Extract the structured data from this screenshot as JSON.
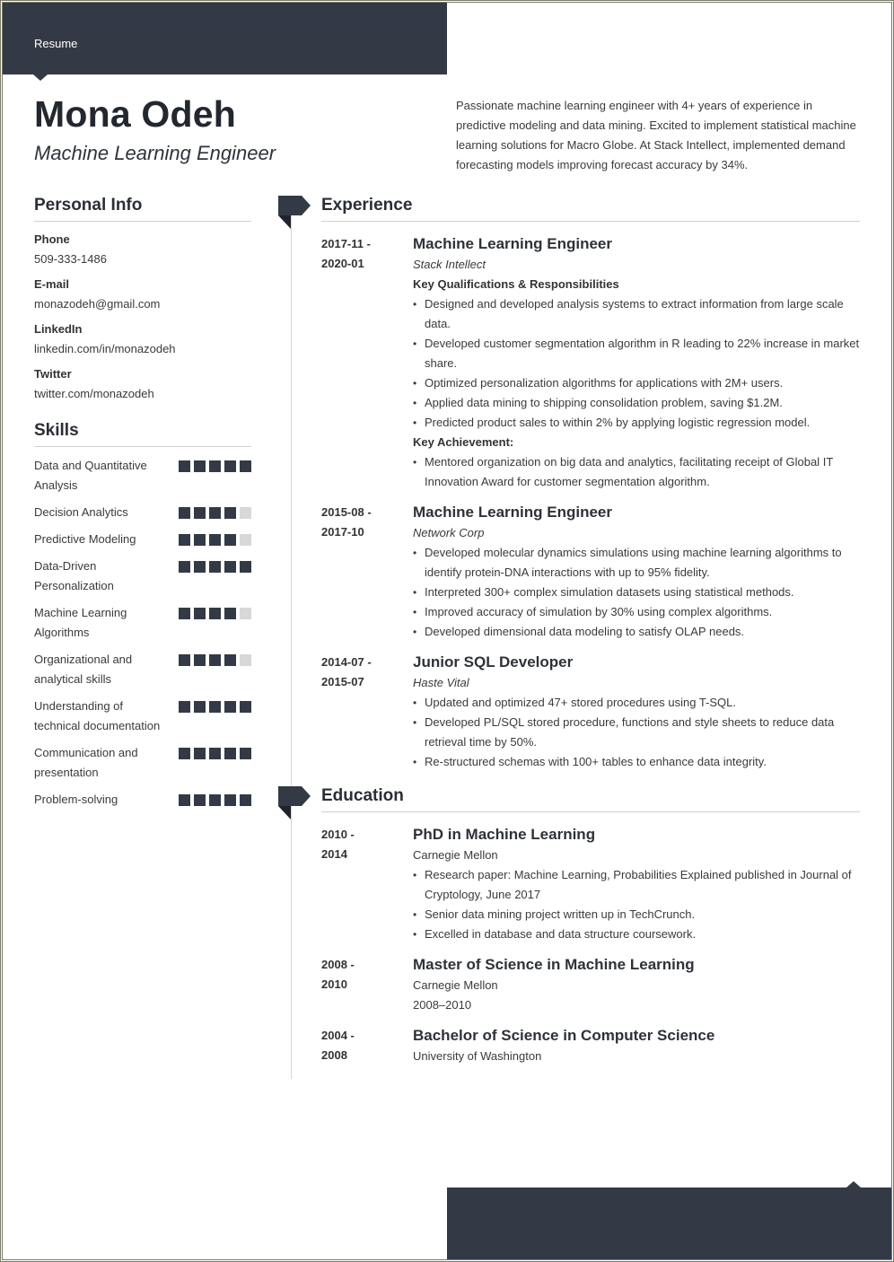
{
  "header": {
    "label": "Resume"
  },
  "profile": {
    "name": "Mona Odeh",
    "title": "Machine Learning Engineer",
    "summary": "Passionate machine learning engineer with 4+ years of experience in predictive modeling and data mining. Excited to implement statistical machine learning solutions for Macro Globe. At Stack Intellect, implemented demand forecasting models improving forecast accuracy by 34%."
  },
  "personal_info": {
    "heading": "Personal Info",
    "items": [
      {
        "label": "Phone",
        "value": "509-333-1486"
      },
      {
        "label": "E-mail",
        "value": "monazodeh@gmail.com"
      },
      {
        "label": "LinkedIn",
        "value": "linkedin.com/in/monazodeh"
      },
      {
        "label": "Twitter",
        "value": "twitter.com/monazodeh"
      }
    ]
  },
  "skills": {
    "heading": "Skills",
    "max_level": 5,
    "items": [
      {
        "name": "Data and Quantitative Analysis",
        "level": 5
      },
      {
        "name": "Decision Analytics",
        "level": 4
      },
      {
        "name": "Predictive Modeling",
        "level": 4
      },
      {
        "name": "Data-Driven Personalization",
        "level": 5
      },
      {
        "name": "Machine Learning Algorithms",
        "level": 4
      },
      {
        "name": "Organizational and analytical skills",
        "level": 4
      },
      {
        "name": "Understanding of technical documentation",
        "level": 5
      },
      {
        "name": "Communication and presentation",
        "level": 5
      },
      {
        "name": "Problem-solving",
        "level": 5
      }
    ]
  },
  "experience": {
    "heading": "Experience",
    "entries": [
      {
        "date_start": "2017-11 -",
        "date_end": "2020-01",
        "title": "Machine Learning Engineer",
        "org": "Stack Intellect",
        "subheading": "Key Qualifications & Responsibilities",
        "bullets": [
          "Designed and developed analysis systems to extract information from large scale data.",
          "Developed customer segmentation algorithm in R leading to 22% increase in market share.",
          "Optimized personalization algorithms for applications with 2M+ users.",
          "Applied data mining to shipping consolidation problem, saving $1.2M.",
          "Predicted product sales to within 2% by applying logistic regression model."
        ],
        "subheading2": "Key Achievement:",
        "bullets2": [
          "Mentored organization on big data and analytics, facilitating receipt of Global IT Innovation Award for customer segmentation algorithm."
        ]
      },
      {
        "date_start": "2015-08 -",
        "date_end": "2017-10",
        "title": "Machine Learning Engineer",
        "org": "Network Corp",
        "bullets": [
          "Developed molecular dynamics simulations using machine learning algorithms to identify protein-DNA interactions with up to 95% fidelity.",
          "Interpreted 300+ complex simulation datasets using statistical methods.",
          "Improved accuracy of simulation by 30% using complex algorithms.",
          "Developed dimensional data modeling to satisfy OLAP needs."
        ]
      },
      {
        "date_start": "2014-07 -",
        "date_end": "2015-07",
        "title": "Junior SQL Developer",
        "org": "Haste Vital",
        "bullets": [
          "Updated and optimized 47+ stored procedures using T-SQL.",
          "Developed PL/SQL stored procedure, functions and style sheets to reduce data retrieval time by 50%.",
          "Re-structured schemas with 100+ tables to enhance data integrity."
        ]
      }
    ]
  },
  "education": {
    "heading": "Education",
    "entries": [
      {
        "date_start": "2010 -",
        "date_end": "2014",
        "title": "PhD in Machine Learning",
        "org": "Carnegie Mellon",
        "bullets": [
          "Research paper: Machine Learning, Probabilities Explained published in Journal of Cryptology, June 2017",
          "Senior data mining project written up in TechCrunch.",
          "Excelled in database and data structure coursework."
        ]
      },
      {
        "date_start": "2008 -",
        "date_end": "2010",
        "title": "Master of Science in Machine Learning",
        "org": "Carnegie Mellon",
        "extra": "2008–2010"
      },
      {
        "date_start": "2004 -",
        "date_end": "2008",
        "title": "Bachelor of Science in Computer Science",
        "org": "University of Washington"
      }
    ]
  },
  "colors": {
    "accent": "#343a45",
    "skill_off": "#d8d8d8",
    "rule": "#d0d0d0"
  }
}
